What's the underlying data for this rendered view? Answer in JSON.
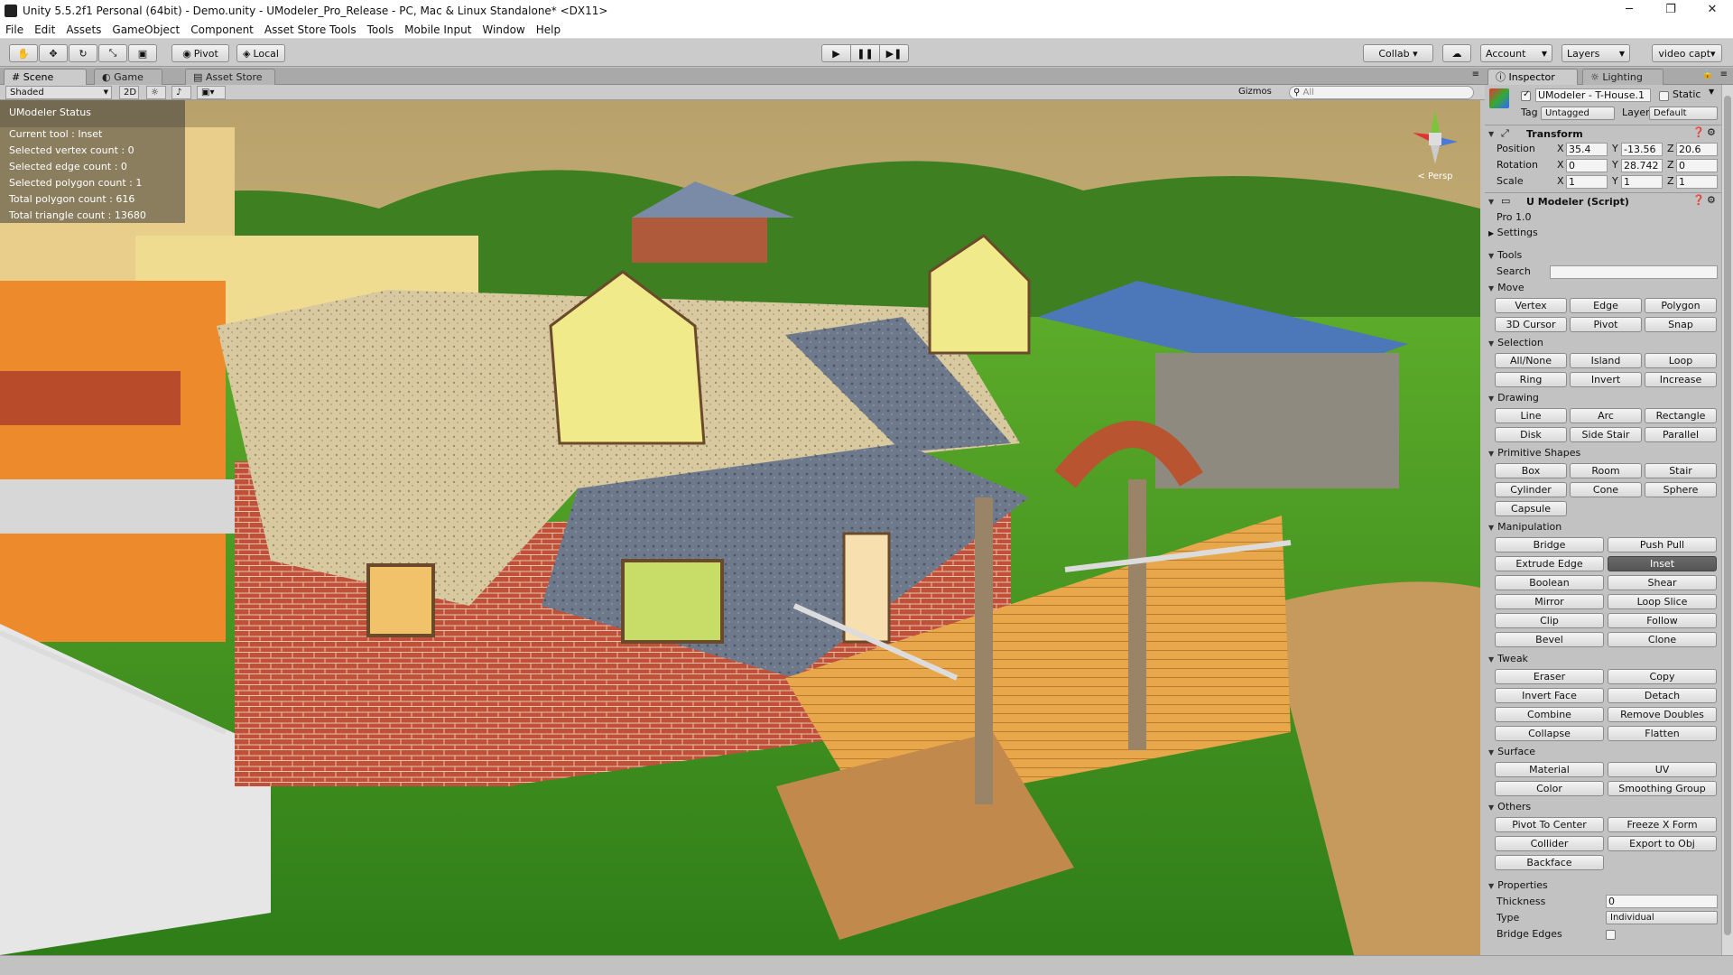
{
  "window": {
    "title": "Unity 5.5.2f1 Personal (64bit) - Demo.unity - UModeler_Pro_Release - PC, Mac & Linux Standalone* <DX11>",
    "minimize": "─",
    "restore": "❐",
    "close": "✕"
  },
  "menu": [
    "File",
    "Edit",
    "Assets",
    "GameObject",
    "Component",
    "Asset Store Tools",
    "Tools",
    "Mobile Input",
    "Window",
    "Help"
  ],
  "toolbar": {
    "pivot": "Pivot",
    "local": "Local",
    "collab": "Collab ▾",
    "account": "Account",
    "layers": "Layers",
    "layout": "video capt▾"
  },
  "tabs": {
    "scene": "Scene",
    "game": "Game",
    "asset_store": "Asset Store",
    "inspector": "Inspector",
    "lighting": "Lighting"
  },
  "scene_bar": {
    "shading": "Shaded",
    "mode2d": "2D",
    "gizmos": "Gizmos ▾",
    "search_placeholder": "All"
  },
  "scene_status": {
    "header": "UModeler Status",
    "lines": [
      "Current tool : Inset",
      "Selected vertex count : 0",
      "Selected edge count : 0",
      "Selected polygon count : 1",
      "Total polygon count : 616",
      "Total triangle count : 13680"
    ]
  },
  "gizmo_label": "< Persp",
  "inspector": {
    "object_name": "UModeler - T-House.1",
    "static_label": "Static",
    "tag_label": "Tag",
    "tag_value": "Untagged",
    "layer_label": "Layer",
    "layer_value": "Default",
    "transform": {
      "title": "Transform",
      "position_label": "Position",
      "rotation_label": "Rotation",
      "scale_label": "Scale",
      "axis_x": "X",
      "axis_y": "Y",
      "axis_z": "Z",
      "position": {
        "x": "35.4",
        "y": "-13.56",
        "z": "20.6"
      },
      "rotation": {
        "x": "0",
        "y": "28.742",
        "z": "0"
      },
      "scale": {
        "x": "1",
        "y": "1",
        "z": "1"
      }
    },
    "script": {
      "title": "U Modeler (Script)",
      "version": "Pro 1.0",
      "settings": "Settings",
      "tools": "Tools",
      "search_label": "Search"
    },
    "sections": {
      "move": {
        "title": "Move",
        "buttons": [
          "Vertex",
          "Edge",
          "Polygon",
          "3D Cursor",
          "Pivot",
          "Snap"
        ]
      },
      "selection": {
        "title": "Selection",
        "buttons": [
          "All/None",
          "Island",
          "Loop",
          "Ring",
          "Invert",
          "Increase"
        ]
      },
      "drawing": {
        "title": "Drawing",
        "buttons": [
          "Line",
          "Arc",
          "Rectangle",
          "Disk",
          "Side Stair",
          "Parallel"
        ]
      },
      "primitive": {
        "title": "Primitive Shapes",
        "buttons": [
          "Box",
          "Room",
          "Stair",
          "Cylinder",
          "Cone",
          "Sphere",
          "Capsule"
        ]
      },
      "manipulation": {
        "title": "Manipulation",
        "buttons": [
          "Bridge",
          "Push Pull",
          "Extrude Edge",
          "Inset",
          "Boolean",
          "Shear",
          "Mirror",
          "Loop Slice",
          "Clip",
          "Follow",
          "Bevel",
          "Clone"
        ]
      },
      "tweak": {
        "title": "Tweak",
        "buttons": [
          "Eraser",
          "Copy",
          "Invert Face",
          "Detach",
          "Combine",
          "Remove Doubles",
          "Collapse",
          "Flatten"
        ]
      },
      "surface": {
        "title": "Surface",
        "buttons": [
          "Material",
          "UV",
          "Color",
          "Smoothing Group"
        ]
      },
      "others": {
        "title": "Others",
        "buttons": [
          "Pivot To Center",
          "Freeze X Form",
          "Collider",
          "Export to Obj",
          "Backface"
        ]
      }
    },
    "properties": {
      "title": "Properties",
      "thickness_label": "Thickness",
      "thickness_value": "0",
      "type_label": "Type",
      "type_value": "Individual",
      "bridge_label": "Bridge Edges"
    }
  }
}
